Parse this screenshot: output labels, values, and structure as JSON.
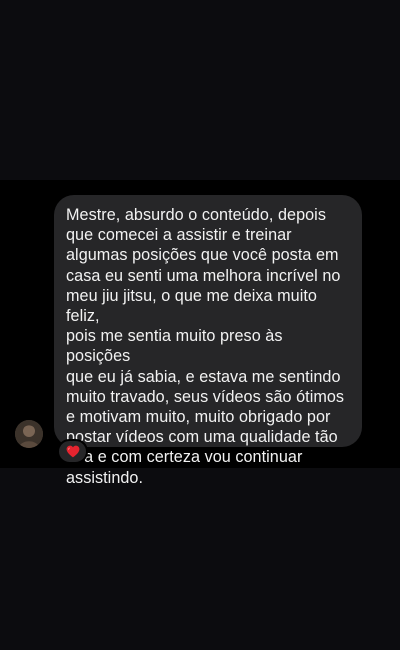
{
  "message": {
    "text": "Mestre, absurdo o conteúdo, depois\nque comecei a assistir e treinar\nalgumas posições que você posta em\ncasa eu senti uma melhora incrível no\nmeu jiu jitsu, o que me deixa muito feliz,\npois me sentia muito preso às posições\nque eu já sabia, e estava me sentindo\nmuito travado, seus vídeos são ótimos\ne motivam muito, muito obrigado por\npostar vídeos com uma qualidade tão\nboa e com certeza vou continuar\nassistindo.",
    "reaction_icon": "heart-icon"
  },
  "colors": {
    "background": "#0b0b0e",
    "chat_band": "#000000",
    "bubble": "#262628",
    "text": "#f2f2f2",
    "heart": "#e5242f"
  }
}
